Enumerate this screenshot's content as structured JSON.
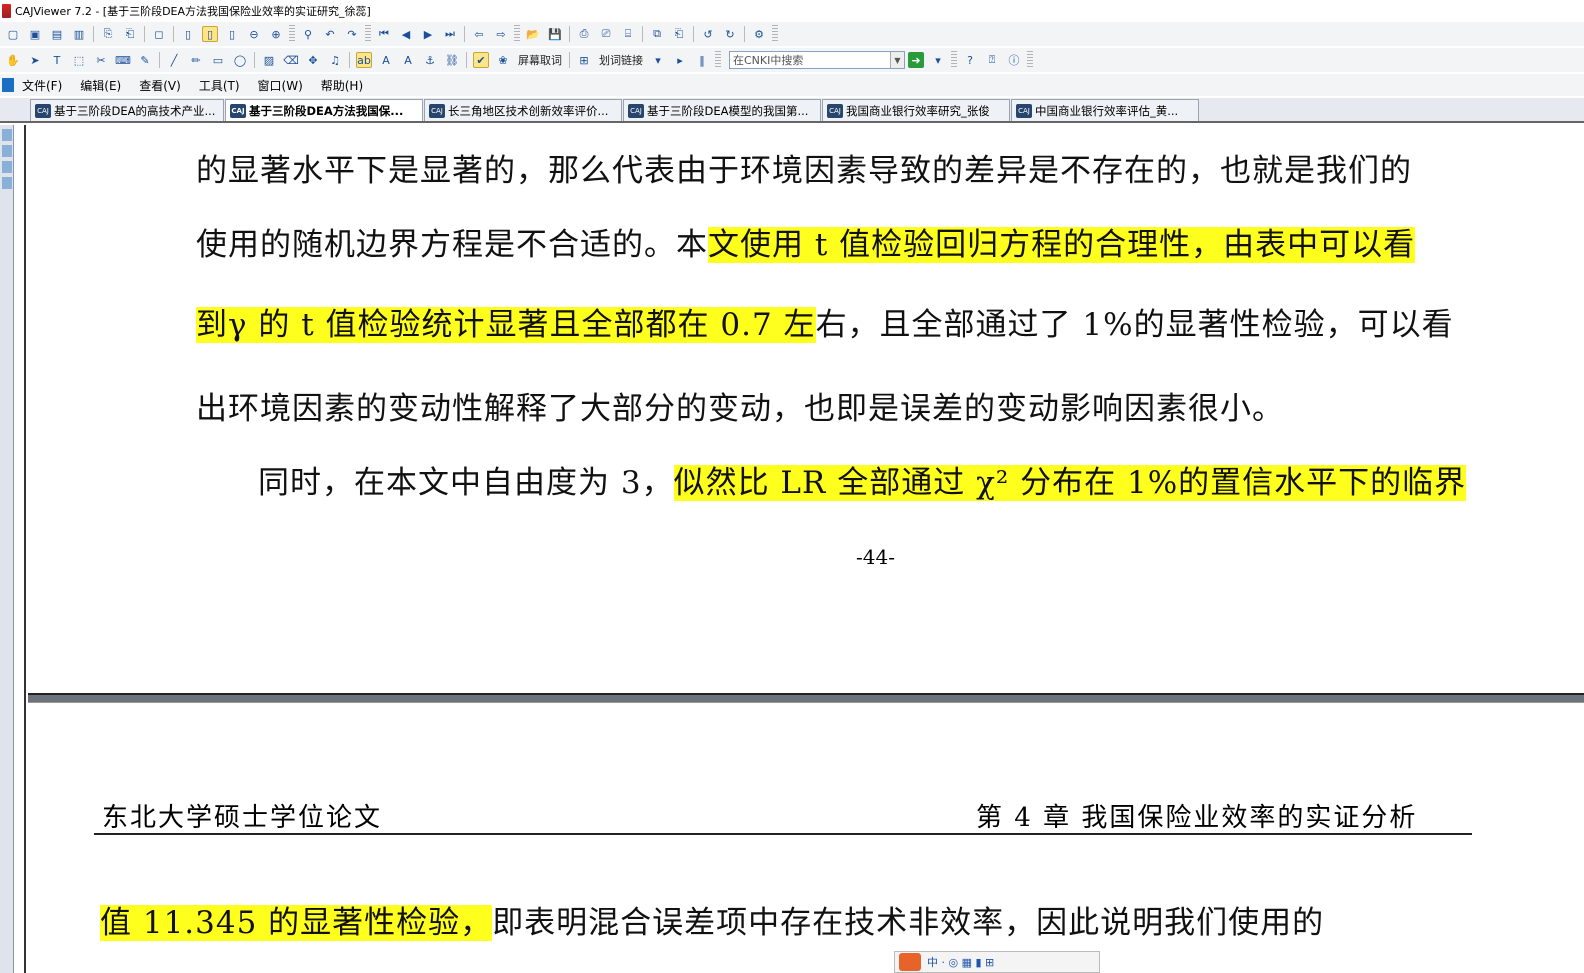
{
  "window": {
    "title": "CAJViewer 7.2 - [基于三阶段DEA方法我国保险业效率的实证研究_徐蕊]"
  },
  "toolbar2": {
    "clear_selection_label": "屏幕取词",
    "word_link_label": "划词链接",
    "search_placeholder": "在CNKI中搜索"
  },
  "menu": [
    {
      "label": "文件(F)"
    },
    {
      "label": "编辑(E)"
    },
    {
      "label": "查看(V)"
    },
    {
      "label": "工具(T)"
    },
    {
      "label": "窗口(W)"
    },
    {
      "label": "帮助(H)"
    }
  ],
  "tabs": [
    {
      "label": "基于三阶段DEA的高技术产业..."
    },
    {
      "label": "基于三阶段DEA方法我国保..."
    },
    {
      "label": "长三角地区技术创新效率评价..."
    },
    {
      "label": "基于三阶段DEA模型的我国第..."
    },
    {
      "label": "我国商业银行效率研究_张俊"
    },
    {
      "label": "中国商业银行效率评估_黄..."
    }
  ],
  "document": {
    "line1": "的显著水平下是显著的，那么代表由于环境因素导致的差异是不存在的，也就是我们的",
    "line2_plain": "使用的随机边界方程是不合适的。本",
    "line2_hl": "文使用 t 值检验回归方程的合理性，由表中可以看",
    "line3_hl": "到γ 的 t 值检验统计显著且全部都在 0.7 左",
    "line3_plain": "右，且全部通过了 1%的显著性检验，可以看",
    "line4": "出环境因素的变动性解释了大部分的变动，也即是误差的变动影响因素很小。",
    "line5_plain": "同时，在本文中自由度为 3，",
    "line5_hl": "似然比 LR 全部通过 χ² 分布在 1%的置信水平下的临界",
    "page_number": "-44-",
    "header_left": "东北大学硕士学位论文",
    "header_right": "第 4 章  我国保险业效率的实证分析",
    "line6_hl": "值  11.345  的显著性检验，",
    "line6_plain": "即表明混合误差项中存在技术非效率，因此说明我们使用的"
  },
  "floatbar": {
    "text": "中 · ◎ ▦ ▮ ⊞"
  },
  "colors": {
    "highlight": "#ffff1e",
    "toolbar_bg": "#f3f4f6",
    "tab_bg": "#e6e9ef"
  }
}
